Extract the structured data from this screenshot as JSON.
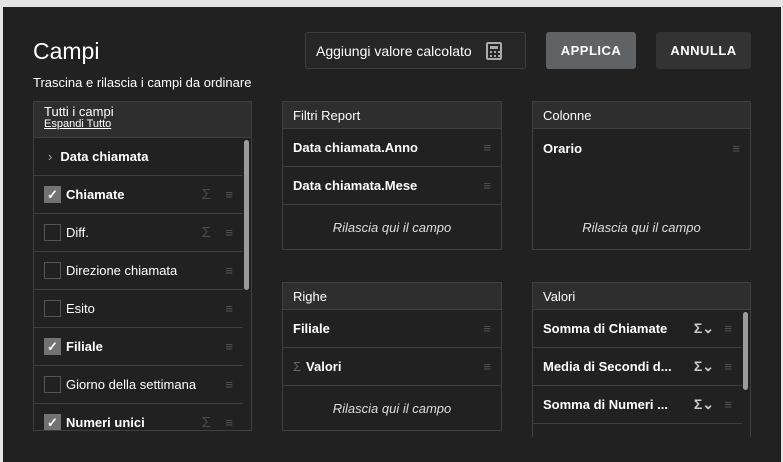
{
  "title": "Campi",
  "subtitle": "Trascina e rilascia i campi da ordinare",
  "buttons": {
    "calc": "Aggiungi valore calcolato",
    "apply": "APPLICA",
    "cancel": "ANNULLA"
  },
  "all_fields": {
    "header": "Tutti i campi",
    "expand": "Espandi Tutto",
    "items": [
      {
        "label": "Data chiamata",
        "checked": false
      },
      {
        "label": "Chiamate",
        "checked": true
      },
      {
        "label": "Diff.",
        "checked": false
      },
      {
        "label": "Direzione chiamata",
        "checked": false
      },
      {
        "label": "Esito",
        "checked": false
      },
      {
        "label": "Filiale",
        "checked": true
      },
      {
        "label": "Giorno della settimana",
        "checked": false
      },
      {
        "label": "Numeri unici",
        "checked": true
      }
    ]
  },
  "filters": {
    "header": "Filtri Report",
    "items": [
      "Data chiamata.Anno",
      "Data chiamata.Mese"
    ],
    "drop": "Rilascia qui il campo"
  },
  "columns": {
    "header": "Colonne",
    "items": [
      "Orario"
    ],
    "drop": "Rilascia qui il campo"
  },
  "rows": {
    "header": "Righe",
    "items": [
      "Filiale",
      "Valori"
    ],
    "drop": "Rilascia qui il campo"
  },
  "values": {
    "header": "Valori",
    "items": [
      "Somma di Chiamate",
      "Media di Secondi d...",
      "Somma di Numeri ..."
    ]
  }
}
